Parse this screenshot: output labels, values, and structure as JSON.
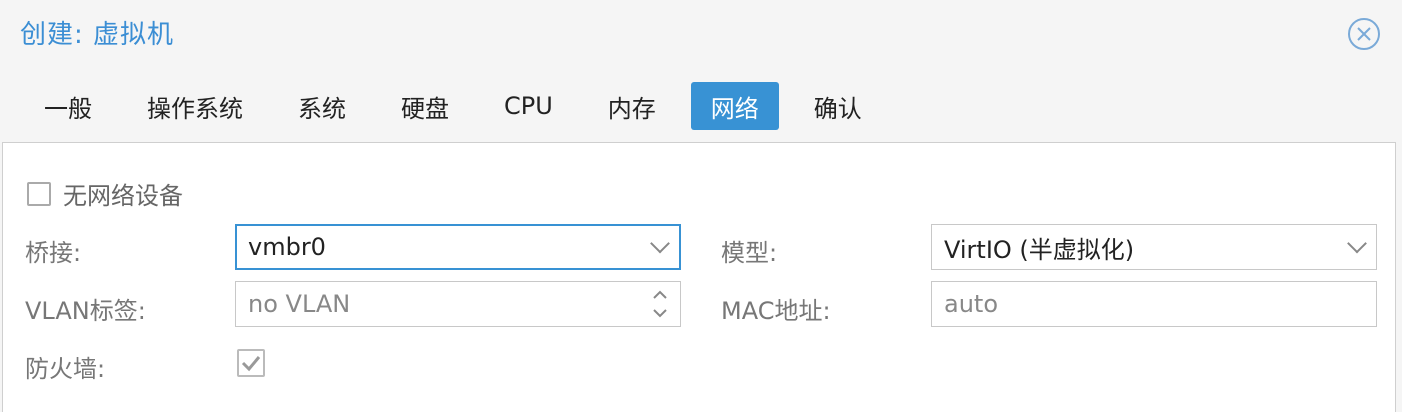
{
  "window": {
    "title": "创建: 虚拟机",
    "close_icon": "close-circle-icon"
  },
  "tabs": [
    {
      "label": "一般",
      "active": false
    },
    {
      "label": "操作系统",
      "active": false
    },
    {
      "label": "系统",
      "active": false
    },
    {
      "label": "硬盘",
      "active": false
    },
    {
      "label": "CPU",
      "active": false
    },
    {
      "label": "内存",
      "active": false
    },
    {
      "label": "网络",
      "active": true
    },
    {
      "label": "确认",
      "active": false
    }
  ],
  "network": {
    "no_network_label": "无网络设备",
    "no_network_checked": false,
    "bridge_label": "桥接:",
    "bridge_value": "vmbr0",
    "vlan_label": "VLAN标签:",
    "vlan_placeholder": "no VLAN",
    "firewall_label": "防火墙:",
    "firewall_checked": true,
    "model_label": "模型:",
    "model_value": "VirtIO (半虚拟化)",
    "mac_label": "MAC地址:",
    "mac_placeholder": "auto"
  },
  "colors": {
    "accent": "#3892d4",
    "title": "#3b8ed4"
  }
}
